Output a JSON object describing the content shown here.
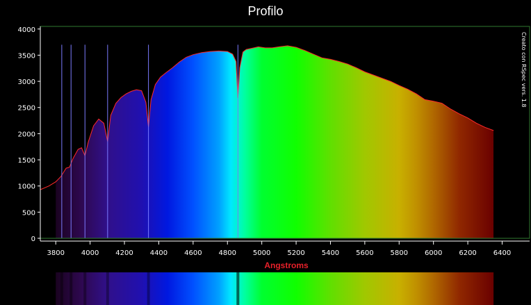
{
  "chart_data": {
    "type": "area",
    "title": "Profilo",
    "xlabel": "Angstroms",
    "ylabel": "",
    "annotation": "Creato con RSpec vers. 1.8",
    "xlim": [
      3710,
      6560
    ],
    "ylim": [
      0,
      4050
    ],
    "x_ticks": [
      3800,
      4000,
      4200,
      4400,
      4600,
      4800,
      5000,
      5200,
      5400,
      5600,
      5800,
      6000,
      6200,
      6400
    ],
    "y_ticks": [
      0,
      500,
      1000,
      1500,
      2000,
      2500,
      3000,
      3500,
      4000
    ],
    "grid": false,
    "colors": {
      "background": "#000000",
      "line": "#ff2a2a",
      "axis": "#ffffff",
      "frame": "#2f7a2f",
      "marker": "#7b7bff",
      "xlabel": "#e8202a"
    },
    "markers": [
      3835,
      3889,
      3970,
      4102,
      4340,
      4861
    ],
    "spectrum_range": [
      3800,
      6350
    ],
    "series": [
      {
        "x": [
          3710,
          3760,
          3800,
          3830,
          3860,
          3880,
          3900,
          3930,
          3950,
          3970,
          3990,
          4020,
          4050,
          4080,
          4102,
          4120,
          4150,
          4180,
          4210,
          4240,
          4270,
          4300,
          4325,
          4340,
          4355,
          4380,
          4410,
          4440,
          4480,
          4520,
          4560,
          4600,
          4650,
          4700,
          4750,
          4800,
          4830,
          4850,
          4861,
          4872,
          4890,
          4910,
          4940,
          4980,
          5020,
          5060,
          5100,
          5150,
          5200,
          5250,
          5300,
          5350,
          5400,
          5450,
          5500,
          5550,
          5600,
          5650,
          5700,
          5750,
          5800,
          5850,
          5900,
          5950,
          6000,
          6050,
          6100,
          6150,
          6200,
          6250,
          6300,
          6350
        ],
        "y": [
          930,
          1000,
          1080,
          1180,
          1340,
          1360,
          1520,
          1700,
          1730,
          1580,
          1850,
          2150,
          2280,
          2200,
          1850,
          2350,
          2580,
          2690,
          2760,
          2810,
          2840,
          2820,
          2600,
          2130,
          2650,
          2940,
          3080,
          3160,
          3260,
          3370,
          3460,
          3510,
          3550,
          3570,
          3580,
          3570,
          3520,
          3380,
          2680,
          3260,
          3560,
          3610,
          3630,
          3660,
          3640,
          3640,
          3660,
          3680,
          3650,
          3590,
          3520,
          3450,
          3420,
          3380,
          3330,
          3260,
          3180,
          3120,
          3060,
          3000,
          2920,
          2850,
          2760,
          2650,
          2620,
          2580,
          2470,
          2380,
          2300,
          2200,
          2120,
          2060
        ]
      }
    ]
  }
}
